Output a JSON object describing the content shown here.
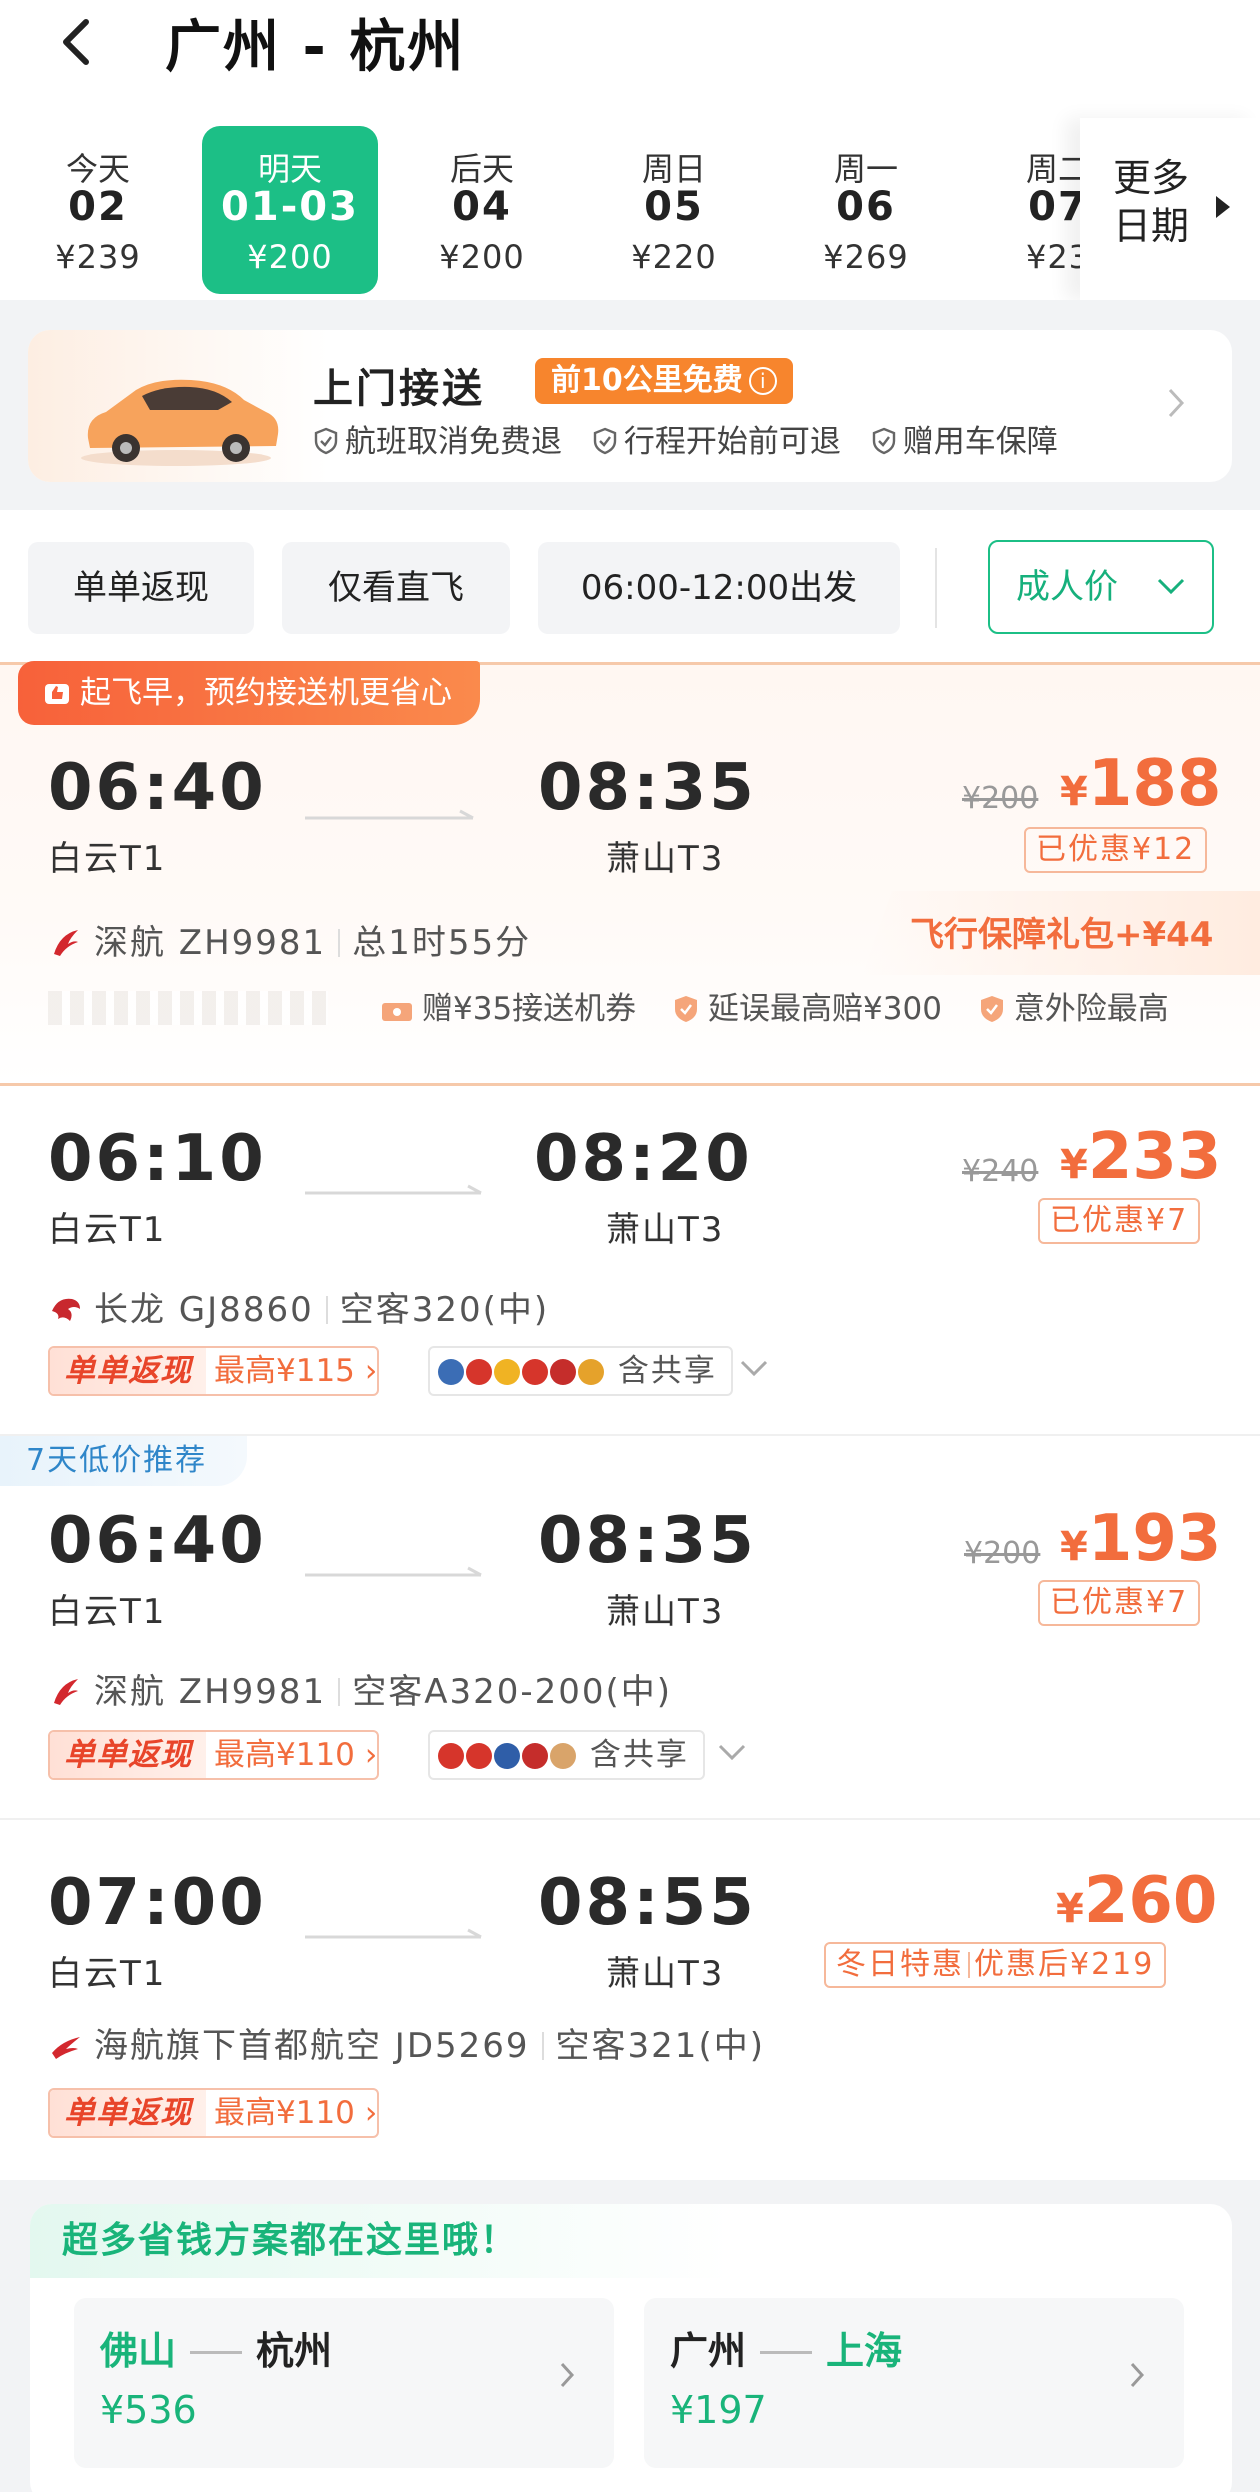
{
  "header": {
    "title": "广州 - 杭州"
  },
  "dates": [
    {
      "label": "今天",
      "date": "02",
      "price": "¥239"
    },
    {
      "label": "明天",
      "date": "01-03",
      "price": "¥200"
    },
    {
      "label": "后天",
      "date": "04",
      "price": "¥200"
    },
    {
      "label": "周日",
      "date": "05",
      "price": "¥220"
    },
    {
      "label": "周一",
      "date": "06",
      "price": "¥269"
    },
    {
      "label": "周二",
      "date": "07",
      "price": "¥23"
    }
  ],
  "more_dates": {
    "line1": "更多",
    "line2": "日期"
  },
  "pickup": {
    "title": "上门接送",
    "badge": "前10公里免费",
    "features": [
      "航班取消免费退",
      "行程开始前可退",
      "赠用车保障"
    ]
  },
  "filters": {
    "chips": [
      "单单返现",
      "仅看直飞",
      "06:00-12:00出发"
    ],
    "adult_price": "成人价"
  },
  "flights": [
    {
      "promo": "起飞早，预约接送机更省心",
      "dep_time": "06:40",
      "dep_term": "白云T1",
      "arr_time": "08:35",
      "arr_term": "萧山T3",
      "old_price": "¥200",
      "price": "188",
      "discount": "已优惠¥12",
      "airline": "深航 ZH9981",
      "detail": "总1时55分",
      "gift": "飞行保障礼包+¥44",
      "perks": [
        "赠¥35接送机券",
        "延误最高赔¥300",
        "意外险最高"
      ]
    },
    {
      "dep_time": "06:10",
      "dep_term": "白云T1",
      "arr_time": "08:20",
      "arr_term": "萧山T3",
      "old_price": "¥240",
      "price": "233",
      "discount": "已优惠¥7",
      "airline": "长龙 GJ8860",
      "detail": "空客320(中)",
      "cashback_label": "单单返现",
      "cashback_max": "最高¥115",
      "share": "含共享"
    },
    {
      "recommend": "7天低价推荐",
      "dep_time": "06:40",
      "dep_term": "白云T1",
      "arr_time": "08:35",
      "arr_term": "萧山T3",
      "old_price": "¥200",
      "price": "193",
      "discount": "已优惠¥7",
      "airline": "深航 ZH9981",
      "detail": "空客A320-200(中)",
      "cashback_label": "单单返现",
      "cashback_max": "最高¥110",
      "share": "含共享"
    },
    {
      "dep_time": "07:00",
      "dep_term": "白云T1",
      "arr_time": "08:55",
      "arr_term": "萧山T3",
      "price": "260",
      "special": "冬日特惠",
      "after_discount": "优惠后¥219",
      "airline": "海航旗下首都航空 JD5269",
      "detail": "空客321(中)",
      "cashback_label": "单单返现",
      "cashback_max": "最高¥110"
    }
  ],
  "savings": {
    "title": "超多省钱方案都在这里哦！",
    "routes": [
      {
        "from": "佛山",
        "to": "杭州",
        "price": "¥536"
      },
      {
        "from": "广州",
        "to": "上海",
        "price": "¥197"
      }
    ]
  },
  "colors": {
    "accent_green": "#1cbf86",
    "price_orange": "#f26d3d",
    "recommend_blue": "#2f86c9"
  },
  "icons": [
    "back-icon",
    "chevron-right-icon",
    "car-icon",
    "shield-icon",
    "chevron-down-icon",
    "thumb-up-icon",
    "airline-logo",
    "ticket-icon"
  ]
}
